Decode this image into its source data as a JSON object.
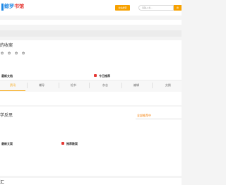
{
  "header": {
    "logo_part1": "鲸罗",
    "logo_part2": "书馆",
    "badge_label": "全站搜索",
    "search_placeholder": "请输入书...",
    "search_button": "搜"
  },
  "section1": {
    "title": "的收案",
    "stars": [
      "✿",
      "✿",
      "✿",
      "✿"
    ],
    "left_panel_title": "最新文档",
    "right_panel_title": "今日推荐",
    "tabs": [
      "资讯",
      "辅导",
      "检书",
      "杂志",
      "编辑",
      "交换"
    ]
  },
  "section2": {
    "title": "学反思",
    "link": "全部推荐中",
    "left_title": "最新文案",
    "right_title": "推荐散案"
  },
  "section3": {
    "title": "汇"
  }
}
